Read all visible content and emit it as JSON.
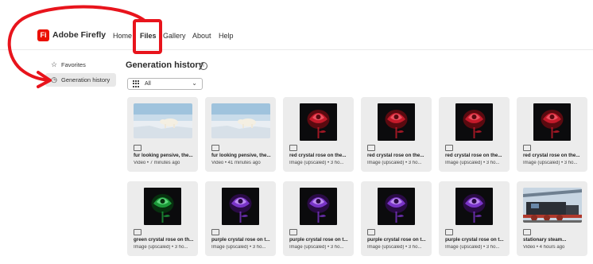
{
  "app": {
    "logo_mark": "Fi",
    "brand": "Adobe Firefly"
  },
  "nav": {
    "items": [
      "Home",
      "Files",
      "Gallery",
      "About",
      "Help"
    ],
    "active": "Files"
  },
  "sidebar": {
    "items": [
      {
        "label": "Favorites",
        "icon": "star-icon"
      },
      {
        "label": "Generation history",
        "icon": "history-icon",
        "active": true
      }
    ]
  },
  "main": {
    "title": "Generation history",
    "filter": {
      "value": "All"
    },
    "cards": [
      {
        "title": "fur looking pensive, the...",
        "meta": "Video • 7 minutes ago",
        "kind": "video",
        "image": "polar-bear"
      },
      {
        "title": "fur looking pensive, the...",
        "meta": "Video • 41 minutes ago",
        "kind": "video",
        "image": "polar-bear"
      },
      {
        "title": "red crystal rose on the...",
        "meta": "Image (upscaled) • 3 ho...",
        "kind": "image",
        "image": "red-rose"
      },
      {
        "title": "red crystal rose on the...",
        "meta": "Image (upscaled) • 3 ho...",
        "kind": "image",
        "image": "red-rose"
      },
      {
        "title": "red crystal rose on the...",
        "meta": "Image (upscaled) • 3 ho...",
        "kind": "image",
        "image": "red-rose"
      },
      {
        "title": "red crystal rose on the...",
        "meta": "Image (upscaled) • 3 ho...",
        "kind": "image",
        "image": "red-rose"
      },
      {
        "title": "green crystal rose on th...",
        "meta": "Image (upscaled) • 3 ho...",
        "kind": "image",
        "image": "green-rose"
      },
      {
        "title": "purple crystal rose on t...",
        "meta": "Image (upscaled) • 3 ho...",
        "kind": "image",
        "image": "purple-rose"
      },
      {
        "title": "purple crystal rose on t...",
        "meta": "Image (upscaled) • 3 ho...",
        "kind": "image",
        "image": "purple-rose"
      },
      {
        "title": "purple crystal rose on t...",
        "meta": "Image (upscaled) • 3 ho...",
        "kind": "image",
        "image": "purple-rose"
      },
      {
        "title": "purple crystal rose on t...",
        "meta": "Image (upscaled) • 3 ho...",
        "kind": "image",
        "image": "purple-rose"
      },
      {
        "title": "stationary steam...",
        "meta": "Video • 4 hours ago",
        "kind": "video",
        "image": "steam-train"
      }
    ]
  },
  "colors": {
    "brand_red": "#eb1000",
    "annotation_red": "#e8141c",
    "card_bg": "#ececec"
  }
}
